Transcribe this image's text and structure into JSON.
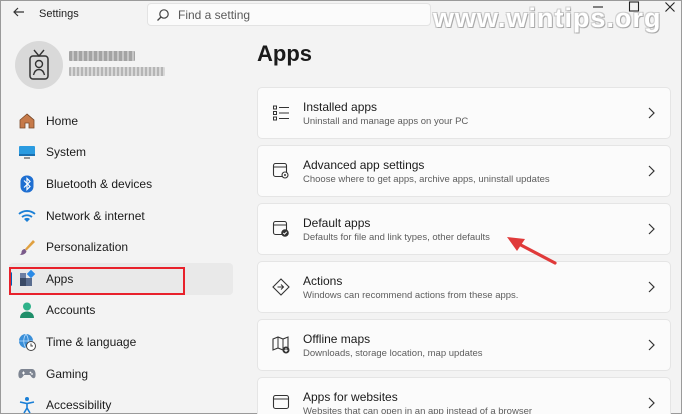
{
  "titlebar": {
    "app_title": "Settings",
    "search_placeholder": "Find a setting",
    "watermark": "www.wintips.org"
  },
  "sidebar": {
    "items": [
      {
        "label": "Home",
        "icon": "home-icon"
      },
      {
        "label": "System",
        "icon": "monitor-icon"
      },
      {
        "label": "Bluetooth & devices",
        "icon": "bluetooth-icon"
      },
      {
        "label": "Network & internet",
        "icon": "wifi-icon"
      },
      {
        "label": "Personalization",
        "icon": "brush-icon"
      },
      {
        "label": "Apps",
        "icon": "apps-icon",
        "selected": true
      },
      {
        "label": "Accounts",
        "icon": "person-icon"
      },
      {
        "label": "Time & language",
        "icon": "globe-clock-icon"
      },
      {
        "label": "Gaming",
        "icon": "gamepad-icon"
      },
      {
        "label": "Accessibility",
        "icon": "accessibility-icon"
      }
    ]
  },
  "main": {
    "title": "Apps",
    "cards": [
      {
        "title": "Installed apps",
        "desc": "Uninstall and manage apps on your PC",
        "icon": "list-icon"
      },
      {
        "title": "Advanced app settings",
        "desc": "Choose where to get apps, archive apps, uninstall updates",
        "icon": "app-settings-icon"
      },
      {
        "title": "Default apps",
        "desc": "Defaults for file and link types, other defaults",
        "icon": "default-apps-icon"
      },
      {
        "title": "Actions",
        "desc": "Windows can recommend actions from these apps.",
        "icon": "actions-icon"
      },
      {
        "title": "Offline maps",
        "desc": "Downloads, storage location, map updates",
        "icon": "map-icon"
      },
      {
        "title": "Apps for websites",
        "desc": "Websites that can open in an app instead of a browser",
        "icon": "web-apps-icon"
      }
    ]
  },
  "colors": {
    "accent": "#005fb8",
    "highlight_box": "#e8212b",
    "annotation_arrow": "#e03a3a"
  }
}
